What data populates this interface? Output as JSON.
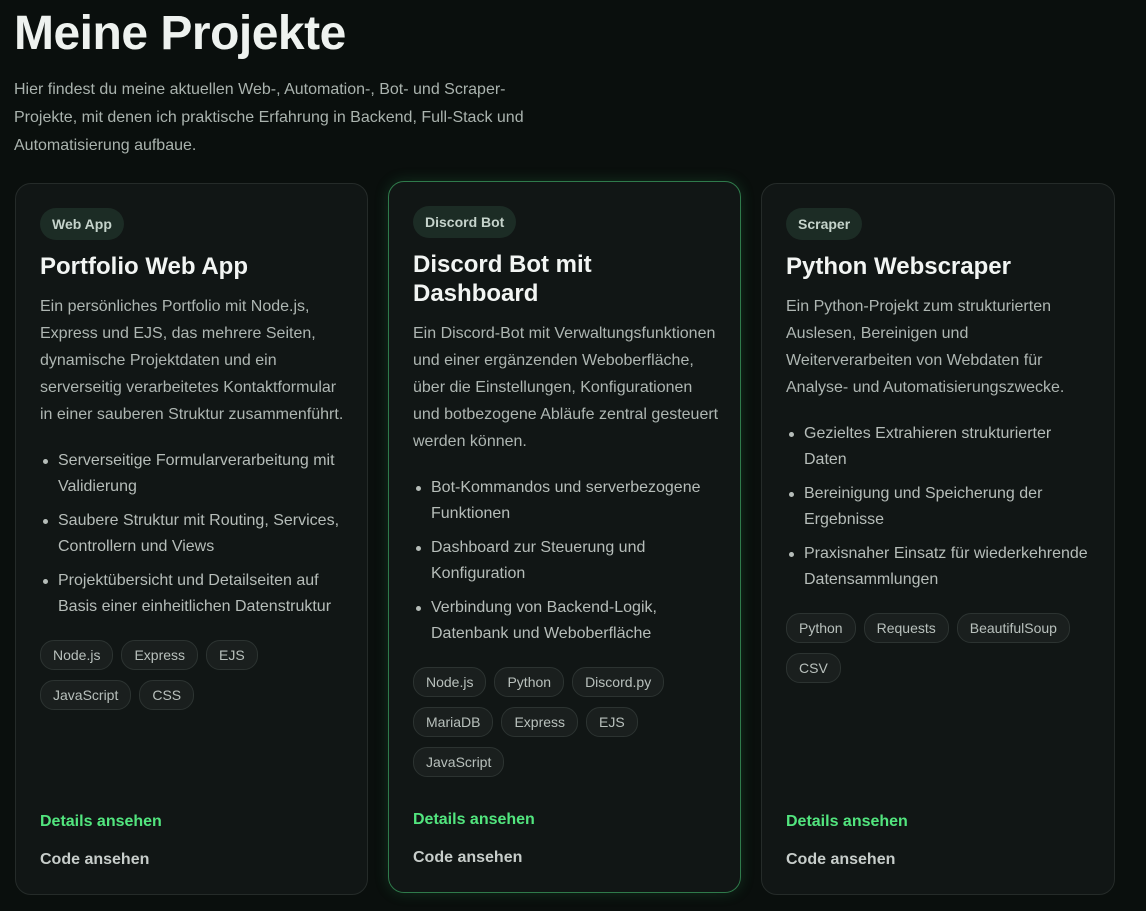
{
  "page": {
    "title": "Meine Projekte",
    "intro": "Hier findest du meine aktuellen Web-, Automation-, Bot- und Scraper-Projekte, mit denen ich praktische Erfahrung in Backend, Full-Stack und Automatisierung aufbaue."
  },
  "colors": {
    "background": "#0a0f0d",
    "card": "#111615",
    "accent_green": "#52e57e",
    "highlight_border": "#2f7a4b"
  },
  "projects": [
    {
      "badge": "Web App",
      "title": "Portfolio Web App",
      "description": "Ein persönliches Portfolio mit Node.js, Express und EJS, das mehrere Seiten, dynamische Projektdaten und ein serverseitig verarbeitetes Kontaktformular in einer sauberen Struktur zusammenführt.",
      "features": [
        "Serverseitige Formularverarbeitung mit Validierung",
        "Saubere Struktur mit Routing, Services, Controllern und Views",
        "Projektübersicht und Detailseiten auf Basis einer einheitlichen Datenstruktur"
      ],
      "tags": [
        "Node.js",
        "Express",
        "EJS",
        "JavaScript",
        "CSS"
      ],
      "details_label": "Details ansehen",
      "code_label": "Code ansehen"
    },
    {
      "badge": "Discord Bot",
      "title": "Discord Bot mit Dashboard",
      "description": "Ein Discord-Bot mit Verwaltungsfunktionen und einer ergänzenden Weboberfläche, über die Einstellungen, Konfigurationen und botbezogene Abläufe zentral gesteuert werden können.",
      "features": [
        "Bot-Kommandos und serverbezogene Funktionen",
        "Dashboard zur Steuerung und Konfiguration",
        "Verbindung von Backend-Logik, Datenbank und Weboberfläche"
      ],
      "tags": [
        "Node.js",
        "Python",
        "Discord.py",
        "MariaDB",
        "Express",
        "EJS",
        "JavaScript"
      ],
      "details_label": "Details ansehen",
      "code_label": "Code ansehen"
    },
    {
      "badge": "Scraper",
      "title": "Python Webscraper",
      "description": "Ein Python-Projekt zum strukturierten Auslesen, Bereinigen und Weiterverarbeiten von Webdaten für Analyse- und Automatisierungszwecke.",
      "features": [
        "Gezieltes Extrahieren strukturierter Daten",
        "Bereinigung und Speicherung der Ergebnisse",
        "Praxisnaher Einsatz für wiederkehrende Datensammlungen"
      ],
      "tags": [
        "Python",
        "Requests",
        "BeautifulSoup",
        "CSV"
      ],
      "details_label": "Details ansehen",
      "code_label": "Code ansehen"
    }
  ]
}
